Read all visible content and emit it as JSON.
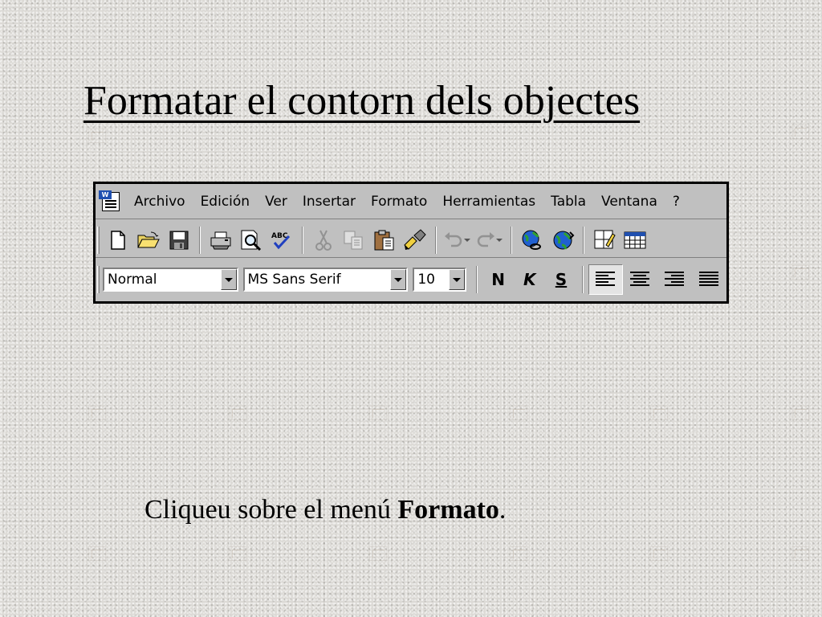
{
  "slide": {
    "title": "Formatar el contorn dels objectes",
    "caption_prefix": "Cliqueu sobre el menú ",
    "caption_bold": "Formato",
    "caption_suffix": "."
  },
  "menubar": {
    "items": [
      "Archivo",
      "Edición",
      "Ver",
      "Insertar",
      "Formato",
      "Herramientas",
      "Tabla",
      "Ventana",
      "?"
    ]
  },
  "formatting": {
    "style_value": "Normal",
    "font_value": "MS Sans Serif",
    "size_value": "10",
    "bold_label": "N",
    "italic_label": "K",
    "underline_label": "S"
  },
  "icons": {
    "standard": [
      "new-document-icon",
      "open-folder-icon",
      "save-icon",
      "print-icon",
      "print-preview-icon",
      "spelling-icon",
      "cut-icon",
      "copy-icon",
      "paste-icon",
      "format-painter-icon",
      "undo-icon",
      "redo-icon",
      "insert-hyperlink-icon",
      "web-toolbar-icon",
      "tables-borders-icon",
      "insert-table-icon"
    ],
    "alignment": [
      "align-left-icon",
      "center-icon",
      "align-right-icon",
      "justify-icon"
    ]
  },
  "colors": {
    "toolbar_bg": "#c0c0c0",
    "slide_bg": "#dcdad6"
  }
}
